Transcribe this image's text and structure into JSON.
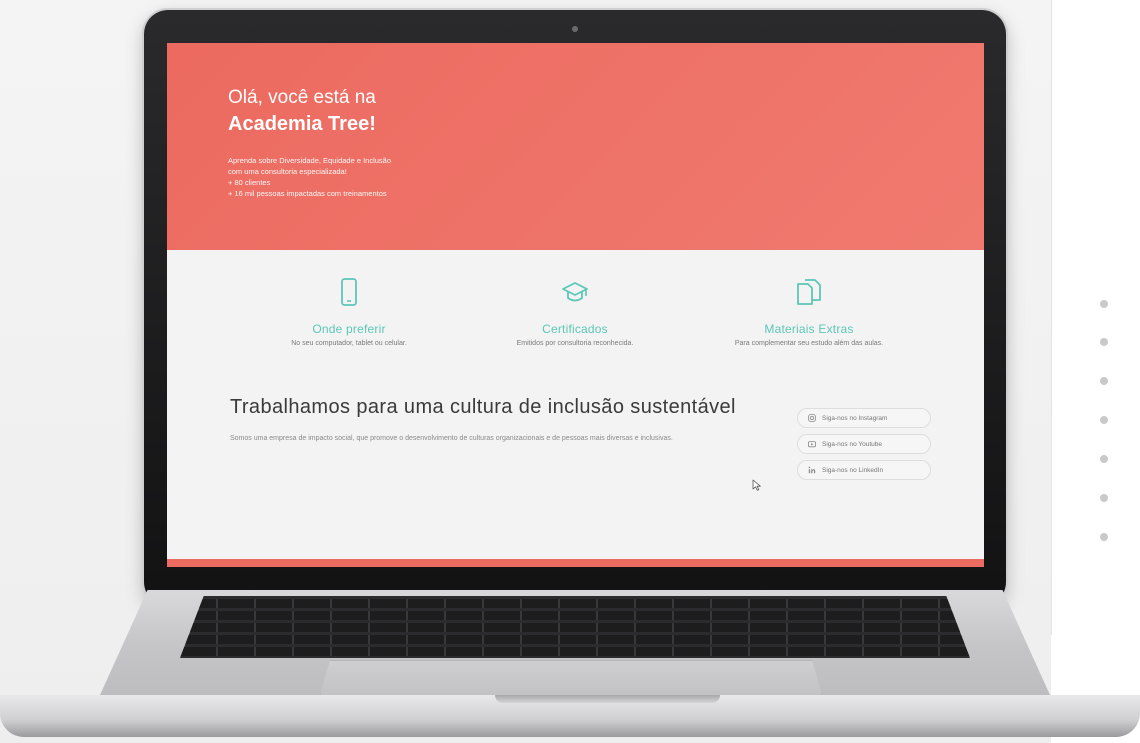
{
  "hero": {
    "greeting": "Olá, você está na",
    "title": "Academia Tree!",
    "lines": [
      "Aprenda sobre Diversidade, Equidade e Inclusão",
      "com uma consultoria especializada!",
      "+ 80 clientes",
      "+ 16 mil pessoas impactadas com treinamentos"
    ]
  },
  "features": [
    {
      "icon": "smartphone-icon",
      "title": "Onde preferir",
      "desc": "No seu computador, tablet ou celular."
    },
    {
      "icon": "graduation-cap-icon",
      "title": "Certificados",
      "desc": "Emitidos por consultoria reconhecida."
    },
    {
      "icon": "documents-icon",
      "title": "Materiais Extras",
      "desc": "Para complementar seu estudo além das aulas."
    }
  ],
  "mission": {
    "title": "Trabalhamos para uma cultura de inclusão sustentável",
    "text": "Somos uma empresa de impacto social, que promove o desenvolvimento de culturas organizacionais e de pessoas mais diversas e inclusivas."
  },
  "social": [
    {
      "icon": "instagram-icon",
      "label": "Siga-nos no Instagram"
    },
    {
      "icon": "youtube-icon",
      "label": "Siga-nos no Youtube"
    },
    {
      "icon": "linkedin-icon",
      "label": "Siga-nos no LinkedIn"
    }
  ],
  "colors": {
    "accent": "#ec6a60",
    "teal": "#5cc7b7",
    "page_background": "#f3f3f3"
  }
}
